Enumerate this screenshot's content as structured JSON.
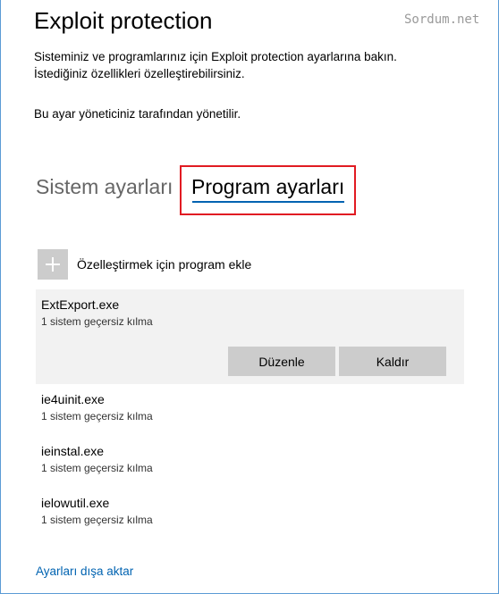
{
  "header": {
    "title": "Exploit protection",
    "watermark": "Sordum.net"
  },
  "description": {
    "line1": "Sisteminiz ve programlarınız için Exploit protection ayarlarına bakın.",
    "line2": "İstediğiniz özellikleri özelleştirebilirsiniz."
  },
  "managed_notice": "Bu ayar yöneticiniz tarafından yönetilir.",
  "tabs": [
    {
      "label": "Sistem ayarları",
      "selected": false
    },
    {
      "label": "Program ayarları",
      "selected": true
    }
  ],
  "add_program": {
    "label": "Özelleştirmek için program ekle",
    "icon": "plus-icon"
  },
  "programs": [
    {
      "name": "ExtExport.exe",
      "status": "1 sistem geçersiz kılma",
      "selected": true
    },
    {
      "name": "ie4uinit.exe",
      "status": "1 sistem geçersiz kılma",
      "selected": false
    },
    {
      "name": "ieinstal.exe",
      "status": "1 sistem geçersiz kılma",
      "selected": false
    },
    {
      "name": "ielowutil.exe",
      "status": "1 sistem geçersiz kılma",
      "selected": false
    }
  ],
  "actions": {
    "edit_label": "Düzenle",
    "remove_label": "Kaldır"
  },
  "export_link": "Ayarları dışa aktar",
  "colors": {
    "accent": "#0063b1",
    "highlight": "#e11b22",
    "selected_bg": "#f2f2f2",
    "button_bg": "#cccccc"
  }
}
